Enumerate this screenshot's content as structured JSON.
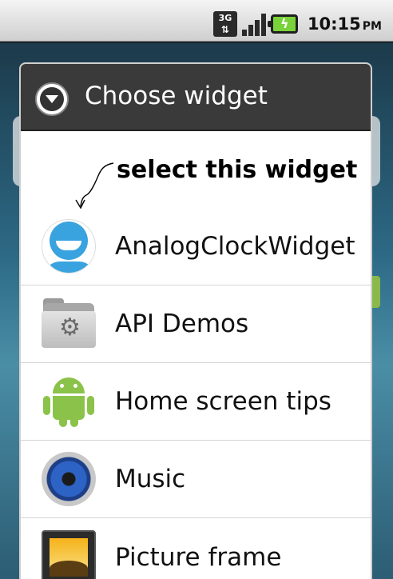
{
  "status_bar": {
    "network": "3G",
    "time": "10:15",
    "ampm": "PM"
  },
  "dialog": {
    "title": "Choose widget",
    "annotation": "select this widget",
    "items": [
      {
        "label": "AnalogClockWidget",
        "icon": "analog-clock-widget-icon"
      },
      {
        "label": "API Demos",
        "icon": "api-demos-folder-icon"
      },
      {
        "label": "Home screen tips",
        "icon": "android-robot-icon"
      },
      {
        "label": "Music",
        "icon": "music-speaker-icon"
      },
      {
        "label": "Picture frame",
        "icon": "picture-frame-icon"
      }
    ]
  }
}
